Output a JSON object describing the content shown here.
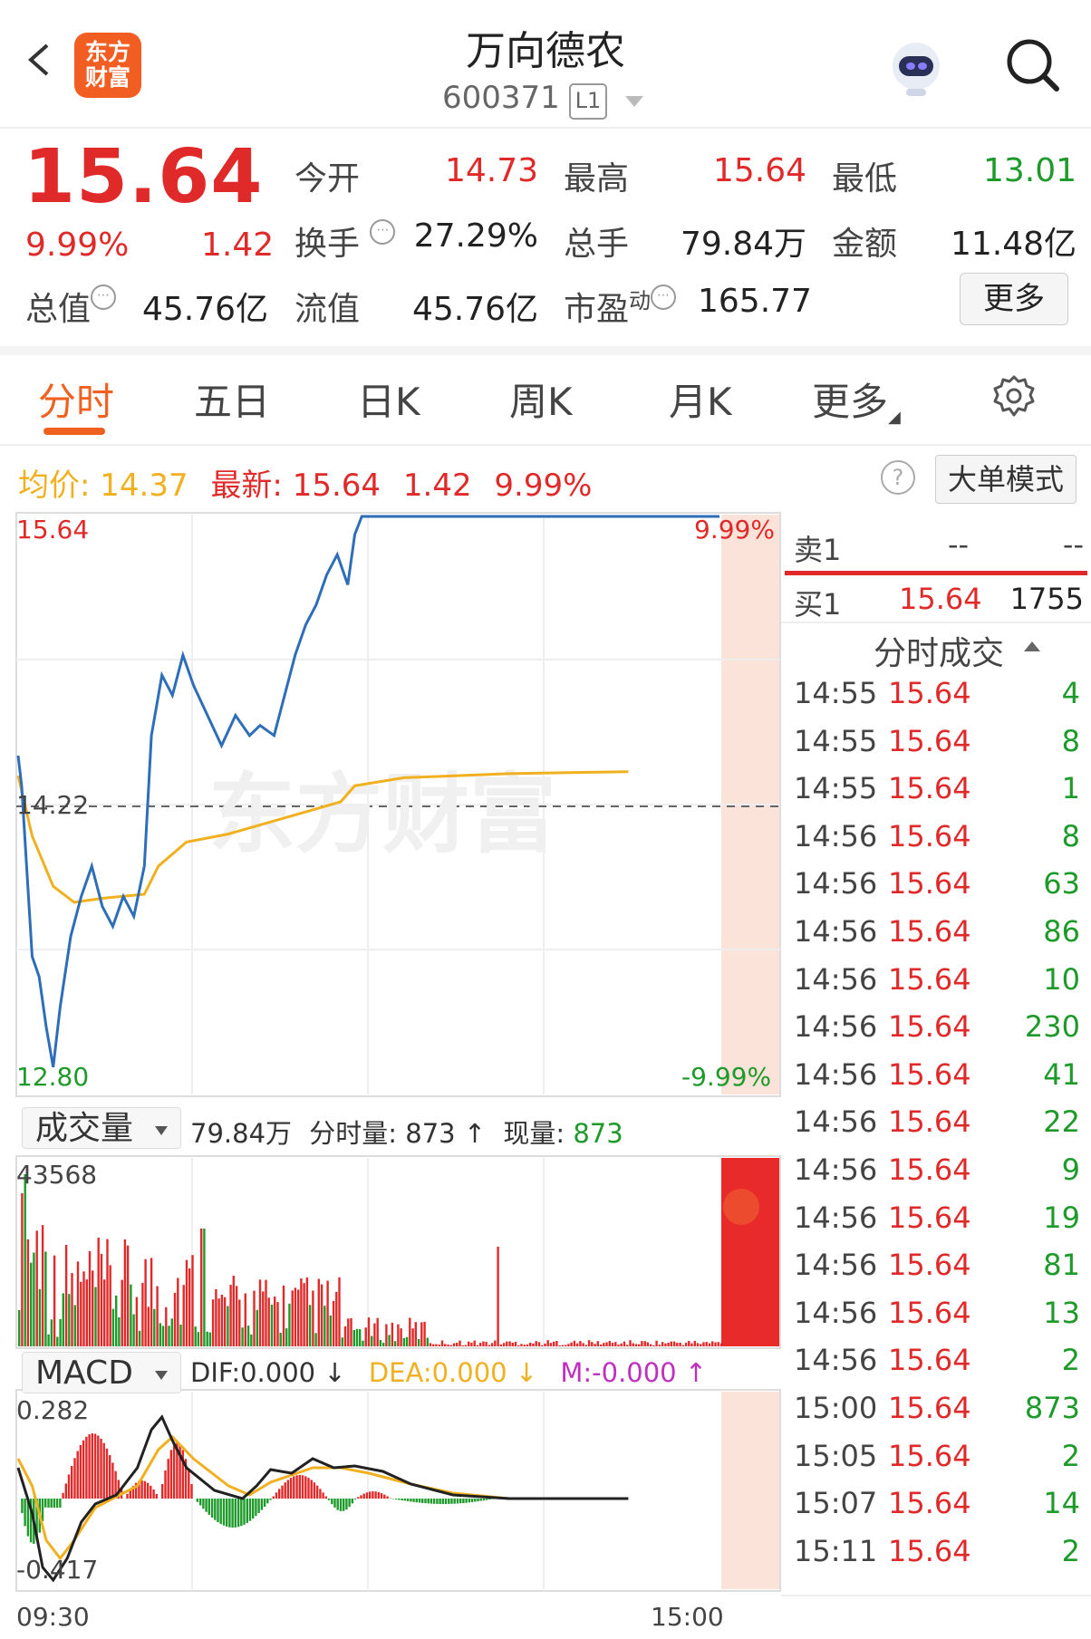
{
  "header": {
    "logo_text": "东方\n财富",
    "stock_name": "万向德农",
    "stock_code": "600371",
    "level_badge": "L1"
  },
  "quote": {
    "price": "15.64",
    "change_pct": "9.99%",
    "change_amt": "1.42",
    "fields": [
      {
        "label": "今开",
        "value": "14.73",
        "color": "red"
      },
      {
        "label": "最高",
        "value": "15.64",
        "color": "red"
      },
      {
        "label": "最低",
        "value": "13.01",
        "color": "green"
      },
      {
        "label": "换手",
        "value": "27.29%",
        "color": "black"
      },
      {
        "label": "总手",
        "value": "79.84万",
        "color": "black"
      },
      {
        "label": "金额",
        "value": "11.48亿",
        "color": "black"
      },
      {
        "label": "总值",
        "value": "45.76亿",
        "color": "black"
      },
      {
        "label": "流值",
        "value": "45.76亿",
        "color": "black"
      },
      {
        "label": "市盈",
        "label_sup": "动",
        "value": "165.77",
        "color": "black"
      }
    ],
    "more_label": "更多"
  },
  "tabs": [
    "分时",
    "五日",
    "日K",
    "周K",
    "月K",
    "更多"
  ],
  "info_line": {
    "avg_label": "均价:",
    "avg_value": "14.37",
    "latest_label": "最新:",
    "latest_price": "15.64",
    "latest_chg": "1.42",
    "latest_pct": "9.99%",
    "help": "?",
    "big_order_btn": "大单模式"
  },
  "intraday": {
    "y_top_label": "15.64",
    "y_bottom_label": "12.80",
    "y_mid_label": "14.22",
    "pct_top_label": "9.99%",
    "pct_bottom_label": "-9.99%",
    "watermark": "东方财富"
  },
  "volume": {
    "selector": "成交量",
    "summary_total": "79.84万",
    "summary_label": "分时量:",
    "summary_value": "873",
    "summary_arrow": "↑",
    "now_label": "现量:",
    "now_value": "873",
    "max_label": "43568"
  },
  "macd": {
    "selector": "MACD",
    "dif": "DIF:0.000 ↓",
    "dea": "DEA:0.000 ↓",
    "m": "M:-0.000 ↑",
    "top_label": "0.282",
    "bottom_label": "-0.417"
  },
  "x_axis": {
    "start": "09:30",
    "end": "15:00"
  },
  "order_book": {
    "sell1_label": "卖1",
    "sell1_price": "--",
    "sell1_vol": "--",
    "buy1_label": "买1",
    "buy1_price": "15.64",
    "buy1_vol": "1755"
  },
  "trades_header": "分时成交",
  "trades": [
    {
      "time": "14:55",
      "price": "15.64",
      "vol": "4"
    },
    {
      "time": "14:55",
      "price": "15.64",
      "vol": "8"
    },
    {
      "time": "14:55",
      "price": "15.64",
      "vol": "1"
    },
    {
      "time": "14:56",
      "price": "15.64",
      "vol": "8"
    },
    {
      "time": "14:56",
      "price": "15.64",
      "vol": "63"
    },
    {
      "time": "14:56",
      "price": "15.64",
      "vol": "86"
    },
    {
      "time": "14:56",
      "price": "15.64",
      "vol": "10"
    },
    {
      "time": "14:56",
      "price": "15.64",
      "vol": "230"
    },
    {
      "time": "14:56",
      "price": "15.64",
      "vol": "41"
    },
    {
      "time": "14:56",
      "price": "15.64",
      "vol": "22"
    },
    {
      "time": "14:56",
      "price": "15.64",
      "vol": "9"
    },
    {
      "time": "14:56",
      "price": "15.64",
      "vol": "19"
    },
    {
      "time": "14:56",
      "price": "15.64",
      "vol": "81"
    },
    {
      "time": "14:56",
      "price": "15.64",
      "vol": "13"
    },
    {
      "time": "14:56",
      "price": "15.64",
      "vol": "2"
    },
    {
      "time": "15:00",
      "price": "15.64",
      "vol": "873"
    },
    {
      "time": "15:05",
      "price": "15.64",
      "vol": "2"
    },
    {
      "time": "15:07",
      "price": "15.64",
      "vol": "14"
    },
    {
      "time": "15:11",
      "price": "15.64",
      "vol": "2"
    }
  ],
  "colors": {
    "up": "#e02a2a",
    "down": "#1e9a2a",
    "price_line": "#2e6eb8",
    "avg_line": "#f0b020",
    "accent": "#f06020",
    "macd_dea": "#f0b020",
    "macd_m": "#c030c0"
  }
}
